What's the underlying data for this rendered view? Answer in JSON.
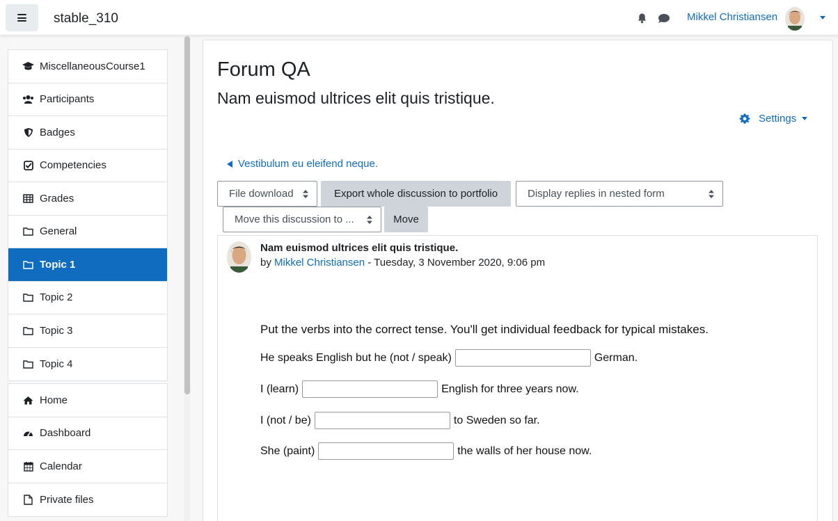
{
  "header": {
    "site_name": "stable_310",
    "user_name": "Mikkel Christiansen"
  },
  "drawer": {
    "course_items": [
      {
        "label": "MiscellaneousCourse1",
        "icon": "graduation-cap-icon",
        "active": false
      },
      {
        "label": "Participants",
        "icon": "users-icon",
        "active": false
      },
      {
        "label": "Badges",
        "icon": "shield-icon",
        "active": false
      },
      {
        "label": "Competencies",
        "icon": "check-square-icon",
        "active": false
      },
      {
        "label": "Grades",
        "icon": "table-icon",
        "active": false
      },
      {
        "label": "General",
        "icon": "folder-icon",
        "active": false
      },
      {
        "label": "Topic 1",
        "icon": "folder-icon",
        "active": true
      },
      {
        "label": "Topic 2",
        "icon": "folder-icon",
        "active": false
      },
      {
        "label": "Topic 3",
        "icon": "folder-icon",
        "active": false
      },
      {
        "label": "Topic 4",
        "icon": "folder-icon",
        "active": false
      }
    ],
    "site_items": [
      {
        "label": "Home",
        "icon": "home-icon"
      },
      {
        "label": "Dashboard",
        "icon": "dashboard-icon"
      },
      {
        "label": "Calendar",
        "icon": "calendar-icon"
      },
      {
        "label": "Private files",
        "icon": "file-icon"
      }
    ]
  },
  "main": {
    "heading": "Forum QA",
    "discussion_title": "Nam euismod ultrices elit quis tristique.",
    "settings_label": "Settings",
    "prev_link": "Vestibulum eu eleifend neque.",
    "controls": {
      "download_select": "File download",
      "export_button": "Export whole discussion to portfolio",
      "display_select": "Display replies in nested form",
      "move_select": "Move this discussion to ...",
      "move_button": "Move"
    },
    "post": {
      "subject": "Nam euismod ultrices elit quis tristique.",
      "by_prefix": "by",
      "author": "Mikkel Christiansen",
      "date": " - Tuesday, 3 November 2020, 9:06 pm",
      "intro": "Put the verbs into the correct tense. You'll get individual feedback for typical mistakes.",
      "questions": [
        {
          "before": "He speaks English but he (not / speak)",
          "after": " German."
        },
        {
          "before": "I (learn)",
          "after": "English for three years now."
        },
        {
          "before": "I (not / be)",
          "after": "to Sweden so far."
        },
        {
          "before": "She (paint)",
          "after": "the walls of her house now."
        }
      ]
    }
  },
  "colors": {
    "brand": "#0f6cbf",
    "button_grey": "#ced4da"
  }
}
